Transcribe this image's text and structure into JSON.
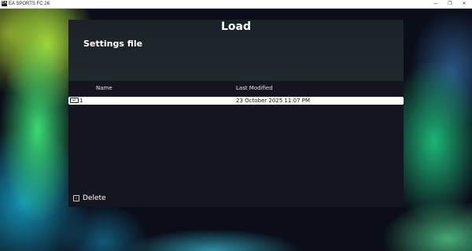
{
  "window": {
    "title": "EA SPORTS FC 26",
    "app_icon": "EA",
    "controls": {
      "minimize": "—",
      "maximize": "❐",
      "close": "✕"
    }
  },
  "dialog": {
    "title": "Load",
    "subtitle": "Settings file",
    "columns": {
      "name": "Name",
      "modified": "Last Modified"
    },
    "rows": [
      {
        "name": "1",
        "modified": "23 October 2025 11:07 PM",
        "icon": "enter-key-icon",
        "selected": true
      }
    ],
    "footer": {
      "delete_label": "Delete",
      "delete_key": "↲",
      "delete_icon": "keyboard-key-icon"
    }
  },
  "colors": {
    "panel": "#15151f",
    "selected_row": "#ffffff",
    "accent_green": "#3ce678",
    "accent_teal": "#14a0c8"
  }
}
